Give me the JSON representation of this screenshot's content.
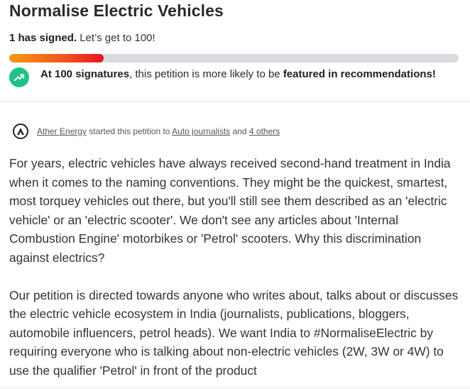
{
  "petition": {
    "title": "Normalise Electric Vehicles",
    "signed_count_text": "1 has signed.",
    "goal_text": "Let’s get to 100!",
    "progress_fraction": 0.21
  },
  "milestone": {
    "bold_lead": "At 100 signatures",
    "middle": ", this petition is more likely to be ",
    "bold_tail": "featured in recommendations!",
    "icon": "trending-up-icon",
    "color": "#21c385"
  },
  "starter": {
    "author": "Ather Energy",
    "started_text": "started this petition to",
    "target": "Auto journalists",
    "and_text": "and",
    "others": "4 others",
    "icon": "ather-logo-icon"
  },
  "body": {
    "paragraph_1": "For years, electric vehicles have always received second-hand treatment in India when it comes to the naming conventions. They might be the quickest, smartest, most torquey vehicles out there, but you'll still see them described as an 'electric vehicle' or an 'electric scooter'. We don't see any articles about 'Internal Combustion Engine' motorbikes or 'Petrol' scooters. Why this discrimination against electrics?",
    "paragraph_2": "Our petition is directed towards anyone who writes about, talks about or discusses the electric vehicle ecosystem in India (journalists, publications, bloggers, automobile influencers, petrol heads). We want India to #NormaliseElectric by requiring everyone who is talking about non-electric vehicles (2W, 3W or 4W) to use the qualifier 'Petrol' in front of the product"
  }
}
